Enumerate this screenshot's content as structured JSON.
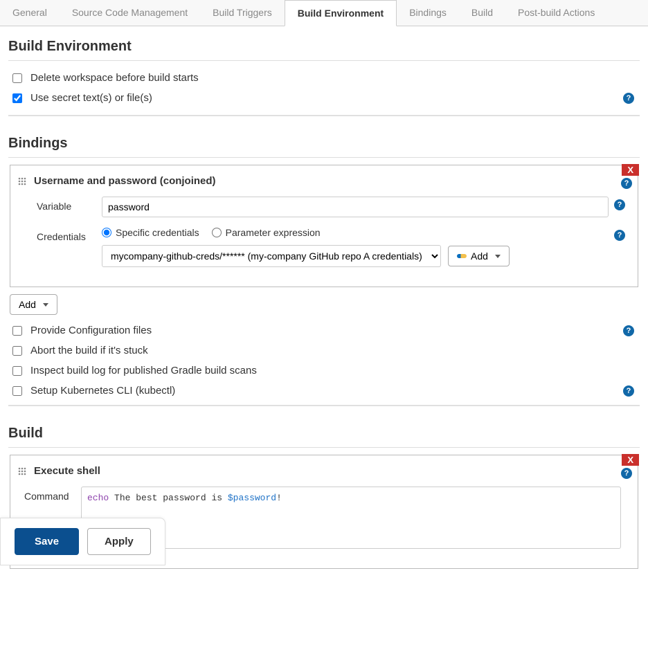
{
  "tabs": {
    "general": "General",
    "scm": "Source Code Management",
    "triggers": "Build Triggers",
    "environment": "Build Environment",
    "bindings": "Bindings",
    "build": "Build",
    "postbuild": "Post-build Actions"
  },
  "sections": {
    "build_env_title": "Build Environment",
    "bindings_title": "Bindings",
    "build_title": "Build"
  },
  "env_checkboxes": {
    "delete_workspace": "Delete workspace before build starts",
    "use_secret": "Use secret text(s) or file(s)"
  },
  "binding": {
    "block_title": "Username and password (conjoined)",
    "variable_label": "Variable",
    "variable_value": "password",
    "credentials_label": "Credentials",
    "specific_radio": "Specific credentials",
    "param_radio": "Parameter expression",
    "cred_select": "mycompany-github-creds/****** (my-company GitHub repo A credentials)",
    "add_cred_btn": "Add",
    "close_x": "X"
  },
  "add_button": "Add",
  "extra_checkboxes": {
    "provide_config": "Provide Configuration files",
    "abort_stuck": "Abort the build if it's stuck",
    "inspect_gradle": "Inspect build log for published Gradle build scans",
    "kubectl": "Setup Kubernetes CLI (kubectl)"
  },
  "build_block": {
    "title": "Execute shell",
    "command_label": "Command",
    "command_keyword": "echo",
    "command_text_plain": " The best password is ",
    "command_var": "$password",
    "command_tail": "!",
    "close_x": "X"
  },
  "footer": {
    "save": "Save",
    "apply": "Apply"
  },
  "help_glyph": "?"
}
